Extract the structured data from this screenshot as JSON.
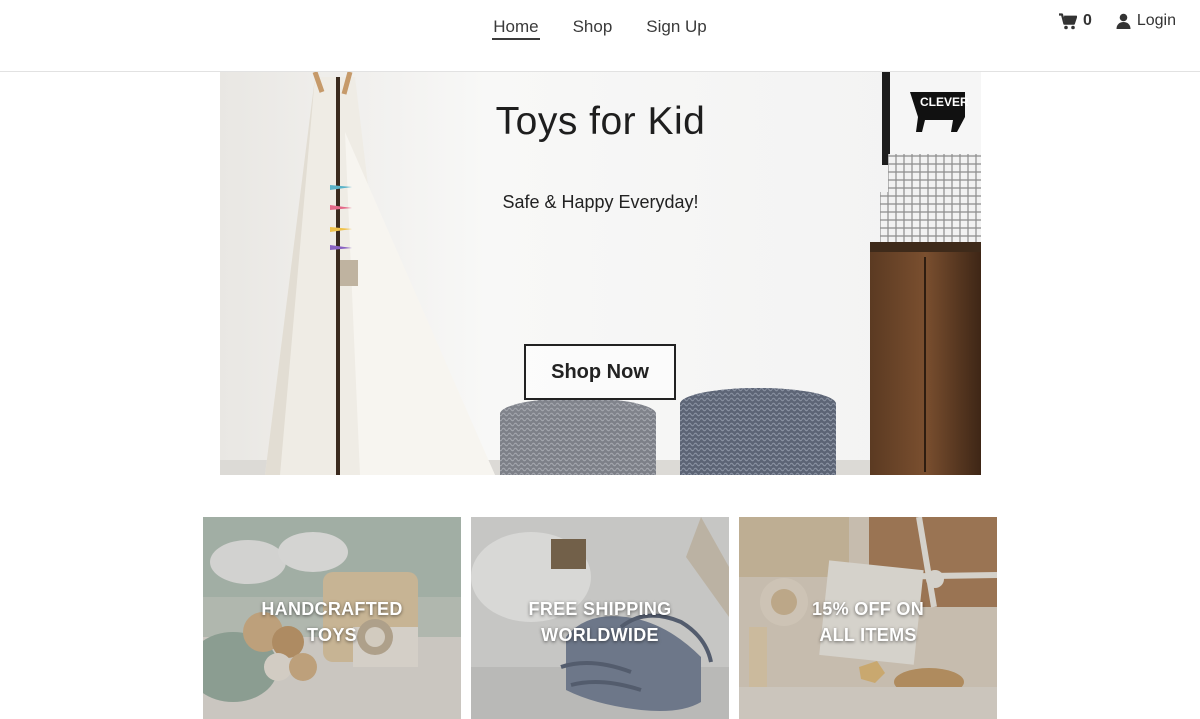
{
  "nav": {
    "links": [
      {
        "label": "Home",
        "active": true
      },
      {
        "label": "Shop",
        "active": false
      },
      {
        "label": "Sign Up",
        "active": false
      }
    ]
  },
  "toolbar": {
    "cart_icon": "cart-icon",
    "cart_count": "0",
    "login_icon": "user-icon",
    "login_label": "Login"
  },
  "hero": {
    "title": "Toys for Kid",
    "subtitle": "Safe & Happy Everyday!",
    "cta_label": "Shop Now",
    "poster_text": "CLEVER"
  },
  "features": [
    {
      "line1": "HANDCRAFTED",
      "line2": "TOYS"
    },
    {
      "line1": "FREE SHIPPING",
      "line2": "WORLDWIDE"
    },
    {
      "line1": "15% OFF ON",
      "line2": "ALL ITEMS"
    }
  ],
  "colors": {
    "text": "#222222",
    "header_border": "#e2e2e2",
    "tile_text": "#ffffff"
  }
}
